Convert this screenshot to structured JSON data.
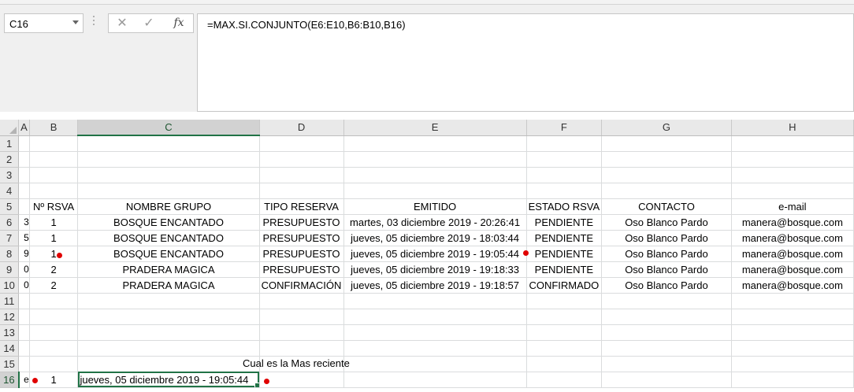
{
  "formula_bar": {
    "name_box": "C16",
    "cancel_icon": "✕",
    "enter_icon": "✓",
    "fx_label": "fx",
    "formula": "=MAX.SI.CONJUNTO(E6:E10,B6:B10,B16)"
  },
  "columns": [
    "A",
    "B",
    "C",
    "D",
    "E",
    "F",
    "G",
    "H"
  ],
  "row_numbers": [
    "1",
    "2",
    "3",
    "4",
    "5",
    "6",
    "7",
    "8",
    "9",
    "10",
    "11",
    "12",
    "13",
    "14",
    "15",
    "16"
  ],
  "header_row": {
    "b": "Nº RSVA",
    "c": "NOMBRE GRUPO",
    "d": "TIPO RESERVA",
    "e": "EMITIDO",
    "f": "ESTADO RSVA",
    "g": "CONTACTO",
    "h": "e-mail"
  },
  "rows": [
    {
      "a": "3",
      "b": "1",
      "c": "BOSQUE ENCANTADO",
      "d": "PRESUPUESTO",
      "e": "martes, 03 diciembre 2019 - 20:26:41",
      "f": "PENDIENTE",
      "g": "Oso Blanco Pardo",
      "h": "manera@bosque.com"
    },
    {
      "a": "5",
      "b": "1",
      "c": "BOSQUE ENCANTADO",
      "d": "PRESUPUESTO",
      "e": "jueves, 05 diciembre 2019 - 18:03:44",
      "f": "PENDIENTE",
      "g": "Oso Blanco Pardo",
      "h": "manera@bosque.com"
    },
    {
      "a": "9",
      "b": "1",
      "c": "BOSQUE ENCANTADO",
      "d": "PRESUPUESTO",
      "e": "jueves, 05 diciembre 2019 - 19:05:44",
      "f": "PENDIENTE",
      "g": "Oso Blanco Pardo",
      "h": "manera@bosque.com"
    },
    {
      "a": "0",
      "b": "2",
      "c": "PRADERA MAGICA",
      "d": "PRESUPUESTO",
      "e": "jueves, 05 diciembre 2019 - 19:18:33",
      "f": "PENDIENTE",
      "g": "Oso Blanco Pardo",
      "h": "manera@bosque.com"
    },
    {
      "a": "0",
      "b": "2",
      "c": "PRADERA MAGICA",
      "d": "CONFIRMACIÓN",
      "e": "jueves, 05 diciembre 2019 - 19:18:57",
      "f": "CONFIRMADO",
      "g": "Oso Blanco Pardo",
      "h": "manera@bosque.com"
    }
  ],
  "annotation": "Cual es la Mas reciente",
  "row16": {
    "a": "e",
    "b": "1",
    "c": "jueves, 05 diciembre 2019 - 19:05:44"
  },
  "colors": {
    "selection": "#217346",
    "marker": "#e00000"
  }
}
